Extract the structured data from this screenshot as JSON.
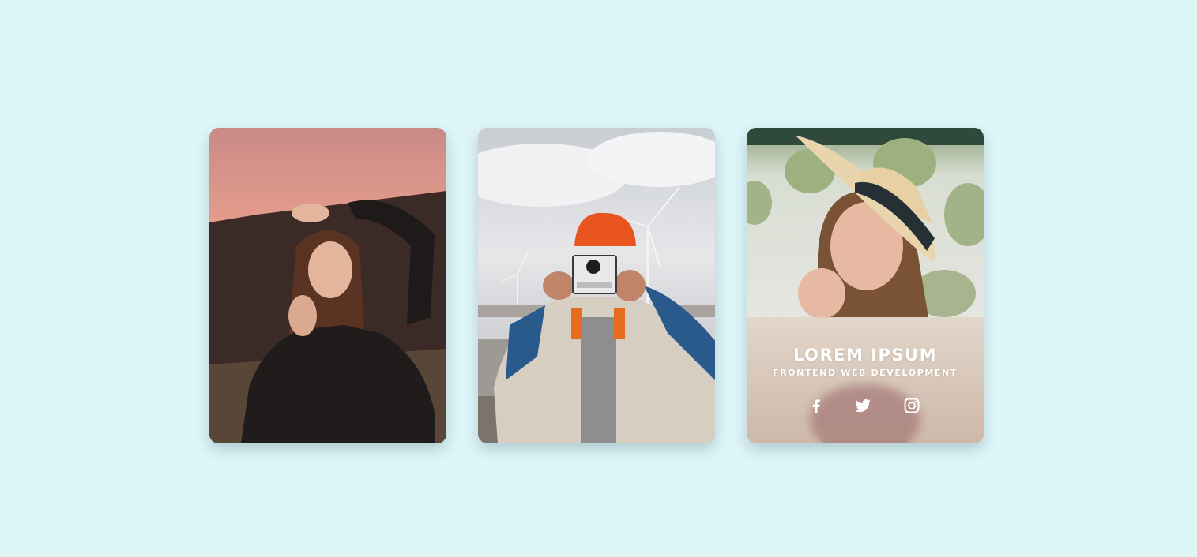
{
  "cards": [
    {
      "photo": "woman-leather-jacket-sunset-photo"
    },
    {
      "photo": "man-polaroid-camera-wind-turbines-photo"
    },
    {
      "photo": "woman-straw-hat-photo",
      "title": "LOREM IPSUM",
      "subtitle": "FRONTEND WEB DEVELOPMENT",
      "social": [
        "facebook-icon",
        "twitter-icon",
        "instagram-icon"
      ]
    }
  ],
  "colors": {
    "background": "#dff6f9",
    "overlay_text": "#ffffff"
  }
}
